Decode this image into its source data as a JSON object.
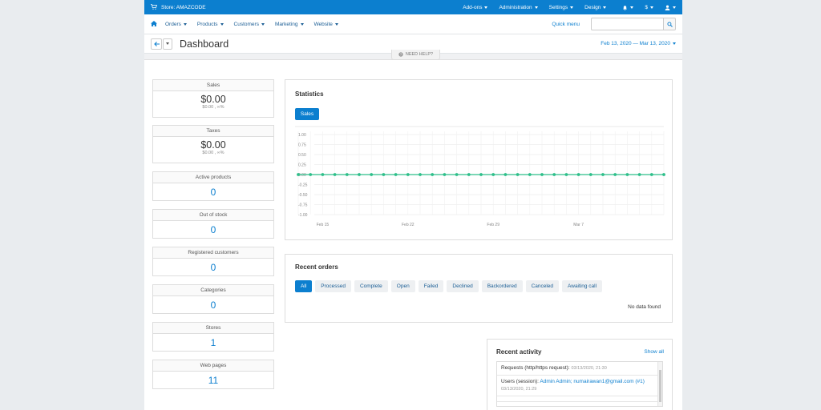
{
  "topbar": {
    "store_label": "Store: AMAZCODE",
    "menu": [
      "Add-ons",
      "Administration",
      "Settings",
      "Design"
    ],
    "currency": "$"
  },
  "nav": {
    "items": [
      "Orders",
      "Products",
      "Customers",
      "Marketing",
      "Website"
    ],
    "quick_menu": "Quick menu",
    "search_value": ""
  },
  "header": {
    "title": "Dashboard",
    "date_range": "Feb 13, 2020 — Mar 13, 2020",
    "need_help": "NEED HELP?"
  },
  "stats": [
    {
      "label": "Sales",
      "value": "$0.00",
      "sub": "$0.00 , ∞%"
    },
    {
      "label": "Taxes",
      "value": "$0.00",
      "sub": "$0.00 , ∞%"
    },
    {
      "label": "Active products",
      "value": "0"
    },
    {
      "label": "Out of stock",
      "value": "0"
    },
    {
      "label": "Registered customers",
      "value": "0"
    },
    {
      "label": "Categories",
      "value": "0"
    },
    {
      "label": "Stores",
      "value": "1"
    },
    {
      "label": "Web pages",
      "value": "11"
    }
  ],
  "statistics": {
    "title": "Statistics",
    "tab": "Sales"
  },
  "chart_data": {
    "type": "line",
    "title": "",
    "xlabel": "",
    "ylabel": "",
    "y_ticks": [
      "1.00",
      "0.75",
      "0.50",
      "0.25",
      "0.00",
      "-0.25",
      "-0.50",
      "-0.75",
      "-1.00"
    ],
    "x_ticks": [
      "Feb 15",
      "Feb 22",
      "Feb 29",
      "Mar 7"
    ],
    "ylim": [
      -1,
      1
    ],
    "grid": true,
    "series": [
      {
        "color": "#2ebf8a",
        "values": [
          0,
          0,
          0,
          0,
          0,
          0,
          0,
          0,
          0,
          0,
          0,
          0,
          0,
          0,
          0,
          0,
          0,
          0,
          0,
          0,
          0,
          0,
          0,
          0,
          0,
          0,
          0,
          0,
          0,
          0,
          0
        ]
      }
    ]
  },
  "recent_orders": {
    "title": "Recent orders",
    "tabs": [
      "All",
      "Processed",
      "Complete",
      "Open",
      "Failed",
      "Declined",
      "Backordered",
      "Canceled",
      "Awaiting call"
    ],
    "active_tab": "All",
    "empty_text": "No data found"
  },
  "recent_activity": {
    "title": "Recent activity",
    "show_all": "Show all",
    "items": [
      {
        "text": "Requests (http/https request):",
        "link": "",
        "time": "03/13/2020, 21:30"
      },
      {
        "text": "Users (session):",
        "link": "Admin Admin; numairawan1@gmail.com (#1)",
        "time": "03/13/2020, 21:29"
      },
      {
        "text": "",
        "link": "",
        "time": ""
      }
    ]
  },
  "colors": {
    "accent": "#0c7fcf",
    "chart_line": "#2ebf8a"
  }
}
